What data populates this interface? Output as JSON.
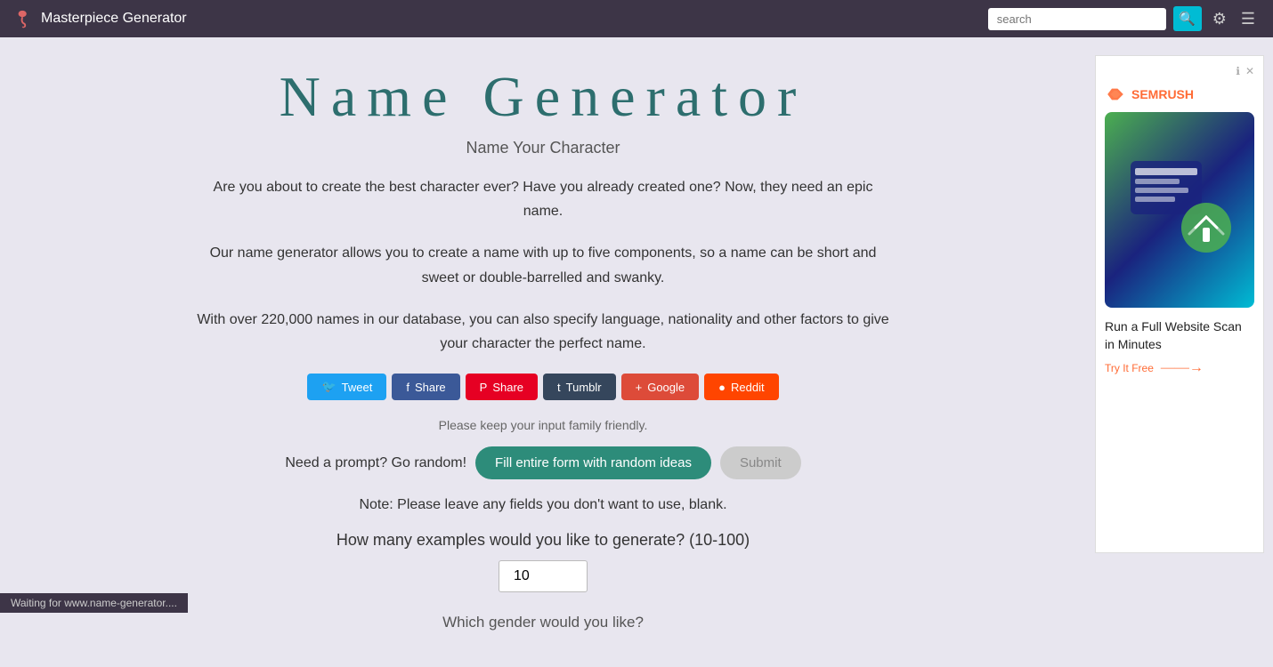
{
  "navbar": {
    "brand": "Masterpiece Generator",
    "search_placeholder": "search",
    "search_icon": "🔍",
    "settings_icon": "⚙",
    "menu_icon": "☰"
  },
  "main": {
    "title": "Name Generator",
    "subtitle": "Name Your Character",
    "desc1": "Are you about to create the best character ever? Have you already created one? Now, they need an epic name.",
    "desc2": "Our name generator allows you to create a name with up to five components, so a name can be short and sweet or double-barrelled and swanky.",
    "desc3": "With over 220,000 names in our database, you can also specify language, nationality and other factors to give your character the perfect name.",
    "family_note": "Please keep your input family friendly.",
    "prompt_text": "Need a prompt? Go random!",
    "fill_random_label": "Fill entire form with random ideas",
    "submit_label": "Submit",
    "note_text": "Note: Please leave any fields you don't want to use, blank.",
    "examples_question": "How many examples would you like to generate? (10-100)",
    "examples_value": "10",
    "next_question": "Which gender would you like?"
  },
  "social_buttons": [
    {
      "label": "Tweet",
      "icon": "𝕏",
      "class": "twitter"
    },
    {
      "label": "Share",
      "icon": "f",
      "class": "facebook"
    },
    {
      "label": "Share",
      "icon": "P",
      "class": "pinterest"
    },
    {
      "label": "Tumblr",
      "icon": "t",
      "class": "tumblr"
    },
    {
      "label": "Google",
      "icon": "+",
      "class": "google"
    },
    {
      "label": "Reddit",
      "icon": "☾",
      "class": "reddit"
    }
  ],
  "ad": {
    "brand": "SEMRUSH",
    "headline": "Run a Full Website Scan in Minutes",
    "cta": "Try It Free",
    "close_label": "✕",
    "info_label": "ℹ"
  },
  "status": {
    "text": "Waiting for www.name-generator...."
  }
}
